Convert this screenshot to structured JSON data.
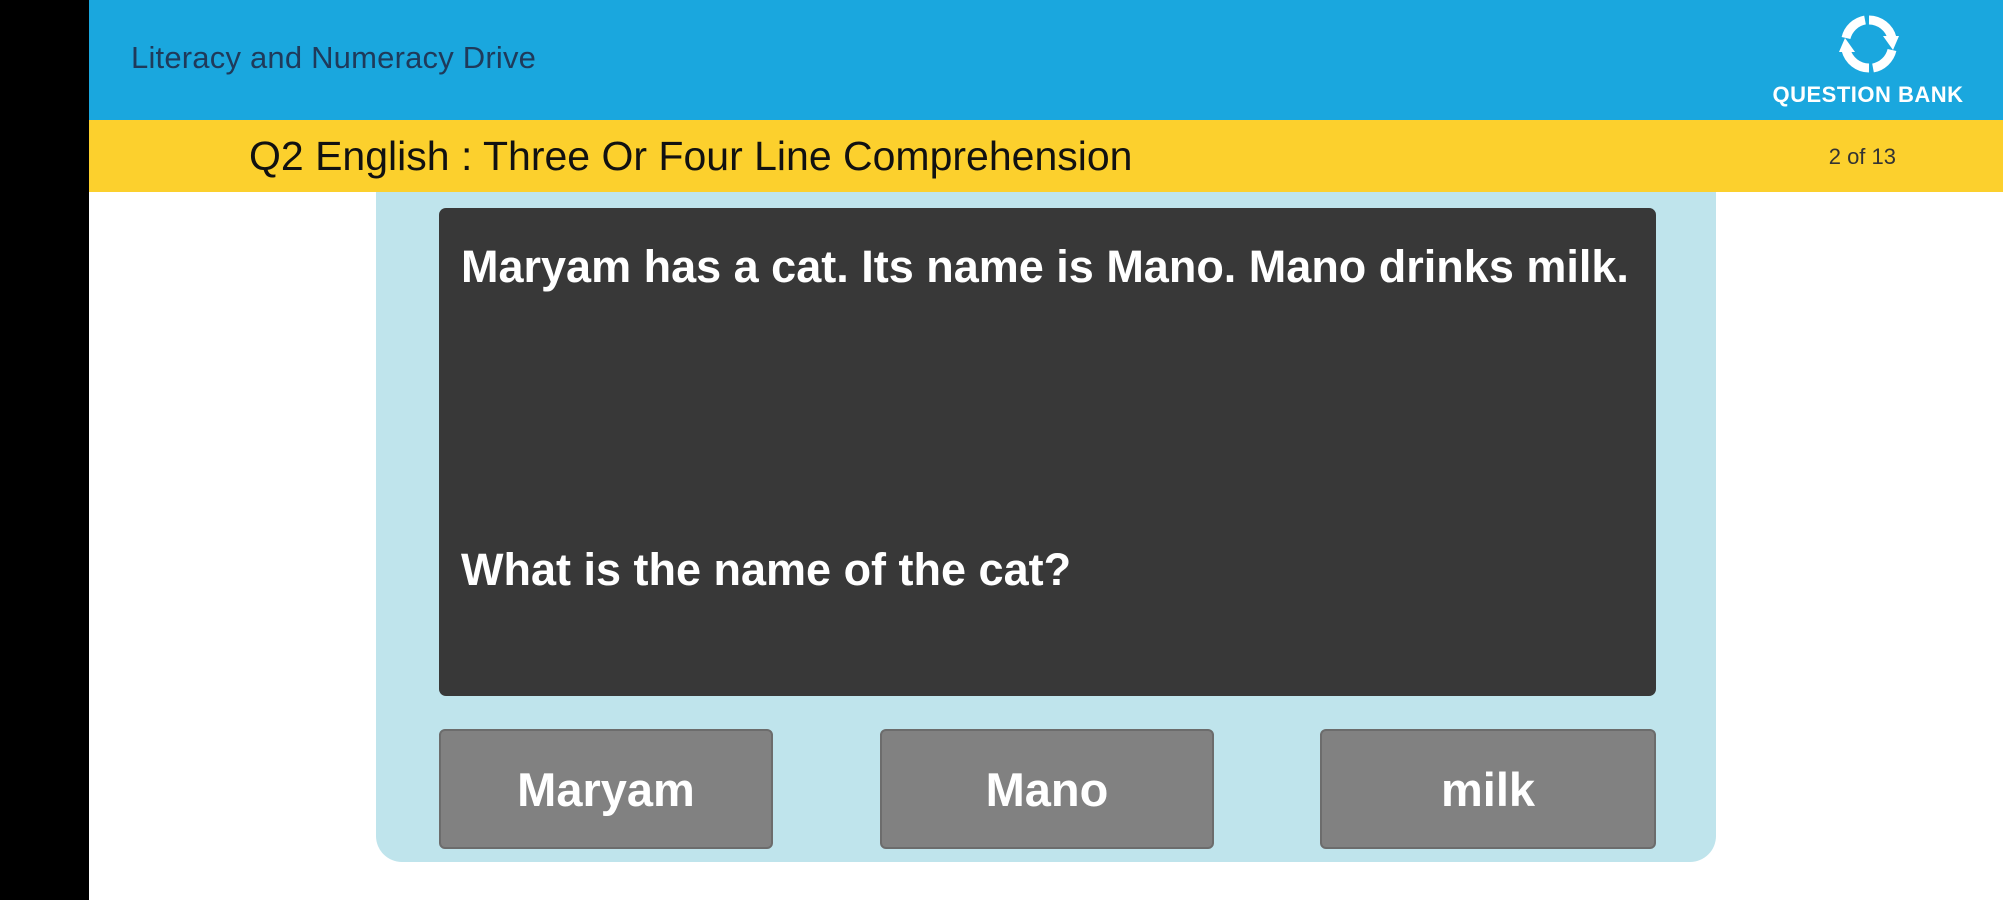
{
  "header": {
    "app_title": "Literacy and Numeracy Drive",
    "logo_text": "QUESTION BANK",
    "logo_icon": "refresh-arrows-icon"
  },
  "subheader": {
    "quiz_title": "Q2 English : Three Or Four Line Comprehension",
    "counter": "2 of 13"
  },
  "question": {
    "passage": "Maryam has a cat. Its name is Mano. Mano drinks milk.",
    "prompt": "What is the name of the cat?"
  },
  "options": [
    {
      "label": "Maryam"
    },
    {
      "label": "Mano"
    },
    {
      "label": "milk"
    }
  ],
  "colors": {
    "topbar": "#1aa7de",
    "subbar": "#fcd02d",
    "panel": "#bfe4ec",
    "question_box": "#383838",
    "option_button": "#818181"
  }
}
